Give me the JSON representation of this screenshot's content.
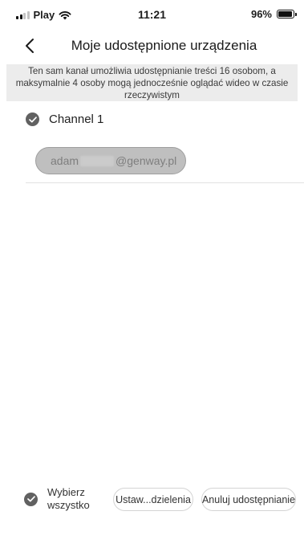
{
  "status_bar": {
    "carrier": "Play",
    "time": "11:21",
    "battery": "96%",
    "battery_level": 0.96,
    "icons": [
      "signal-icon",
      "wifi-icon",
      "battery-icon"
    ]
  },
  "nav": {
    "title": "Moje udostępnione urządzenia",
    "back_icon": "chevron-left-icon"
  },
  "info_banner": {
    "text": "Ten sam kanał umożliwia udostępnianie treści 16 osobom, a maksymalnie 4 osoby mogą jednocześnie oglądać wideo w czasie rzeczywistym"
  },
  "channel": {
    "label": "Channel 1",
    "checked": true
  },
  "shared_user": {
    "email_prefix": "adam",
    "email_domain": "@genway.pl"
  },
  "bottom_bar": {
    "select_all_label": "Wybierz wszystko",
    "settings_button": "Ustaw...dzielenia",
    "cancel_button": "Anuluj udostępnianie"
  },
  "colors": {
    "check_fill": "#616161",
    "chip_fill": "#bfbfbf",
    "banner_bg": "#ececec"
  }
}
